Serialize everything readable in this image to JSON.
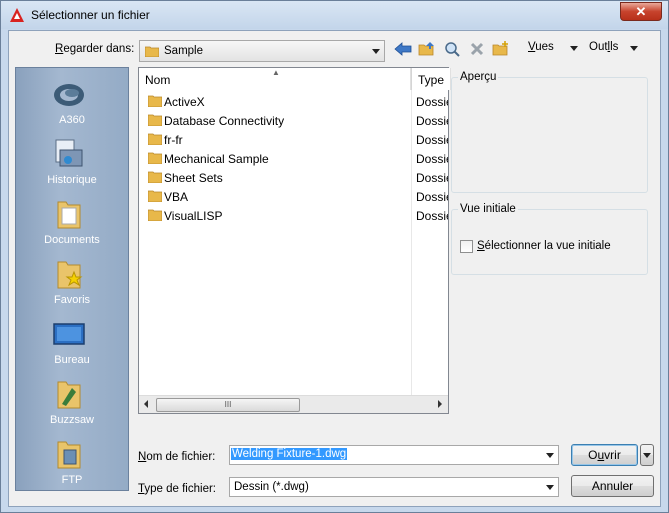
{
  "window": {
    "title": "Sélectionner un fichier"
  },
  "toolbar": {
    "look_in_label": "Regarder dans:",
    "look_in_value": "Sample",
    "views_label": "Vues",
    "tools_label": "Outils"
  },
  "places": [
    {
      "label": "A360",
      "icon": "a360-cloud-icon"
    },
    {
      "label": "Historique",
      "icon": "history-icon"
    },
    {
      "label": "Documents",
      "icon": "documents-folder-icon"
    },
    {
      "label": "Favoris",
      "icon": "favorites-folder-icon"
    },
    {
      "label": "Bureau",
      "icon": "desktop-icon"
    },
    {
      "label": "Buzzsaw",
      "icon": "buzzsaw-icon"
    },
    {
      "label": "FTP",
      "icon": "ftp-icon"
    }
  ],
  "filelist": {
    "columns": {
      "name": "Nom",
      "type": "Type"
    },
    "rows": [
      {
        "name": "ActiveX",
        "type": "Dossier"
      },
      {
        "name": "Database Connectivity",
        "type": "Dossier"
      },
      {
        "name": "fr-fr",
        "type": "Dossier"
      },
      {
        "name": "Mechanical Sample",
        "type": "Dossier"
      },
      {
        "name": "Sheet Sets",
        "type": "Dossier"
      },
      {
        "name": "VBA",
        "type": "Dossier"
      },
      {
        "name": "VisualLISP",
        "type": "Dossier"
      }
    ],
    "scroll_grip": "III"
  },
  "preview": {
    "label": "Aperçu"
  },
  "initial_view": {
    "label": "Vue initiale",
    "checkbox_label": "Sélectionner la vue initiale",
    "checked": false
  },
  "filename": {
    "label": "Nom de fichier:",
    "value": "Welding Fixture-1.dwg"
  },
  "filetype": {
    "label": "Type de fichier:",
    "value": "Dessin (*.dwg)"
  },
  "buttons": {
    "open": "Ouvrir",
    "cancel": "Annuler"
  },
  "colors": {
    "accent": "#3399ff",
    "places_bg": "#9fb3cb",
    "close_red": "#c7432d"
  }
}
